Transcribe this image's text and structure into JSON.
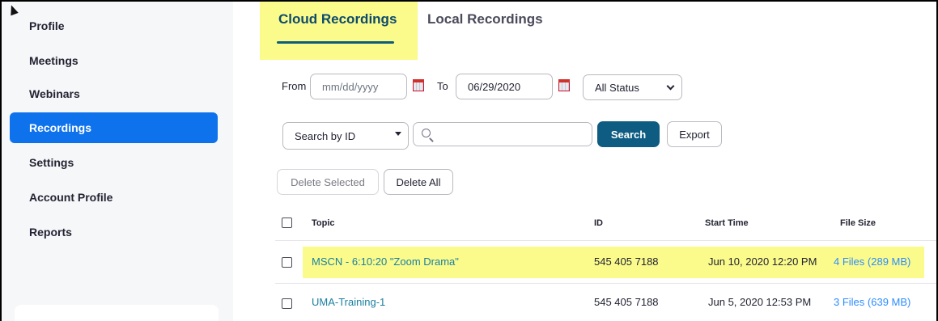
{
  "sidebar": {
    "items": [
      {
        "label": "Profile",
        "active": false
      },
      {
        "label": "Meetings",
        "active": false
      },
      {
        "label": "Webinars",
        "active": false
      },
      {
        "label": "Recordings",
        "active": true
      },
      {
        "label": "Settings",
        "active": false
      },
      {
        "label": "Account Profile",
        "active": false
      },
      {
        "label": "Reports",
        "active": false
      }
    ]
  },
  "tabs": {
    "cloud": "Cloud Recordings",
    "local": "Local Recordings",
    "active": "cloud"
  },
  "filters": {
    "from_label": "From",
    "from_placeholder": "mm/dd/yyyy",
    "to_label": "To",
    "to_value": "06/29/2020",
    "status_value": "All Status"
  },
  "search": {
    "by_value": "Search by ID",
    "query": "",
    "search_label": "Search",
    "export_label": "Export"
  },
  "actions": {
    "delete_selected": "Delete Selected",
    "delete_all": "Delete All"
  },
  "table": {
    "headers": {
      "topic": "Topic",
      "id": "ID",
      "start_time": "Start Time",
      "file_size": "File Size"
    },
    "rows": [
      {
        "topic": "MSCN - 6:10:20 \"Zoom Drama\"",
        "id": "545 405 7188",
        "start_time": "Jun 10, 2020 12:20 PM",
        "file_size": "4 Files (289 MB)",
        "highlighted": true
      },
      {
        "topic": "UMA-Training-1",
        "id": "545 405 7188",
        "start_time": "Jun 5, 2020 12:53 PM",
        "file_size": "3 Files (639 MB)",
        "highlighted": false
      }
    ]
  },
  "colors": {
    "accent": "#0e72ed",
    "primary_button": "#0e5c82",
    "link": "#2d8cff",
    "highlight": "#fbfb8c"
  }
}
